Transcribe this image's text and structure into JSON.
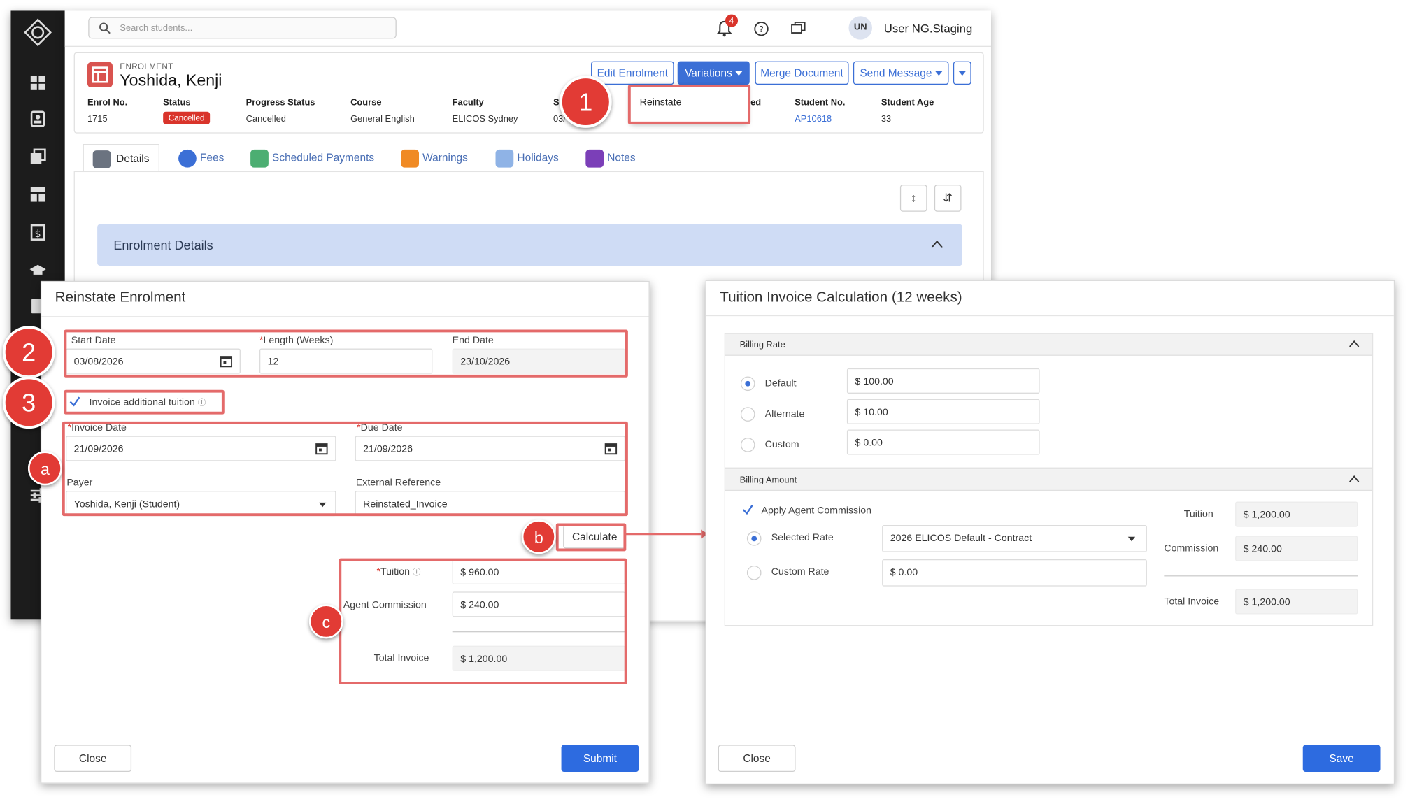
{
  "topbar": {
    "search_placeholder": "Search students...",
    "notification_count": "4",
    "avatar_initials": "UN",
    "user_name": "User NG.Staging"
  },
  "enrolment": {
    "label": "ENROLMENT",
    "name": "Yoshida, Kenji",
    "buttons": {
      "edit": "Edit Enrolment",
      "variations": "Variations",
      "merge": "Merge Document",
      "send": "Send Message"
    },
    "dropdown_item": "Reinstate",
    "fields": [
      {
        "label": "Enrol No.",
        "value": "1715"
      },
      {
        "label": "Status",
        "value": "Cancelled"
      },
      {
        "label": "Progress Status",
        "value": "Cancelled"
      },
      {
        "label": "Course",
        "value": "General English"
      },
      {
        "label": "Faculty",
        "value": "ELICOS Sydney"
      },
      {
        "label": "S",
        "value": "03/"
      },
      {
        "label": "ed",
        "value": ""
      },
      {
        "label": "Student No.",
        "value": "AP10618"
      },
      {
        "label": "Student Age",
        "value": "33"
      }
    ]
  },
  "tabs": [
    "Details",
    "Fees",
    "Scheduled Payments",
    "Warnings",
    "Holidays",
    "Notes"
  ],
  "panel": {
    "title": "Enrolment Details"
  },
  "reinstate_dialog": {
    "title": "Reinstate Enrolment",
    "start_date_label": "Start Date",
    "start_date": "03/08/2026",
    "length_label": "Length (Weeks)",
    "length": "12",
    "end_date_label": "End Date",
    "end_date": "23/10/2026",
    "invoice_additional_label": "Invoice additional tuition",
    "invoice_date_label": "Invoice Date",
    "invoice_date": "21/09/2026",
    "due_date_label": "Due Date",
    "due_date": "21/09/2026",
    "payer_label": "Payer",
    "payer": "Yoshida, Kenji (Student)",
    "external_ref_label": "External Reference",
    "external_ref": "Reinstated_Invoice",
    "calculate": "Calculate",
    "tuition_label": "Tuition",
    "tuition": "$ 960.00",
    "commission_label": "Agent Commission",
    "commission": "$ 240.00",
    "total_label": "Total Invoice",
    "total": "$ 1,200.00",
    "close": "Close",
    "submit": "Submit"
  },
  "calc_dialog": {
    "title": "Tuition Invoice Calculation (12 weeks)",
    "billing_rate": "Billing Rate",
    "rates": [
      {
        "label": "Default",
        "value": "$ 100.00",
        "selected": true
      },
      {
        "label": "Alternate",
        "value": "$ 10.00",
        "selected": false
      },
      {
        "label": "Custom",
        "value": "$ 0.00",
        "selected": false
      }
    ],
    "billing_amount": "Billing Amount",
    "apply_commission": "Apply Agent Commission",
    "selected_rate_label": "Selected Rate",
    "selected_rate": "2026 ELICOS Default - Contract",
    "custom_rate_label": "Custom Rate",
    "custom_rate": "$ 0.00",
    "tuition_label": "Tuition",
    "tuition": "$ 1,200.00",
    "commission_label": "Commission",
    "commission": "$ 240.00",
    "total_label": "Total Invoice",
    "total": "$ 1,200.00",
    "close": "Close",
    "save": "Save"
  },
  "markers": {
    "m1": "1",
    "m2": "2",
    "m3": "3",
    "ma": "a",
    "mb": "b",
    "mc": "c"
  },
  "colors": {
    "accent": "#3b6fd6",
    "annotation": "#e23b35",
    "sidebar": "#1c1c1c"
  }
}
